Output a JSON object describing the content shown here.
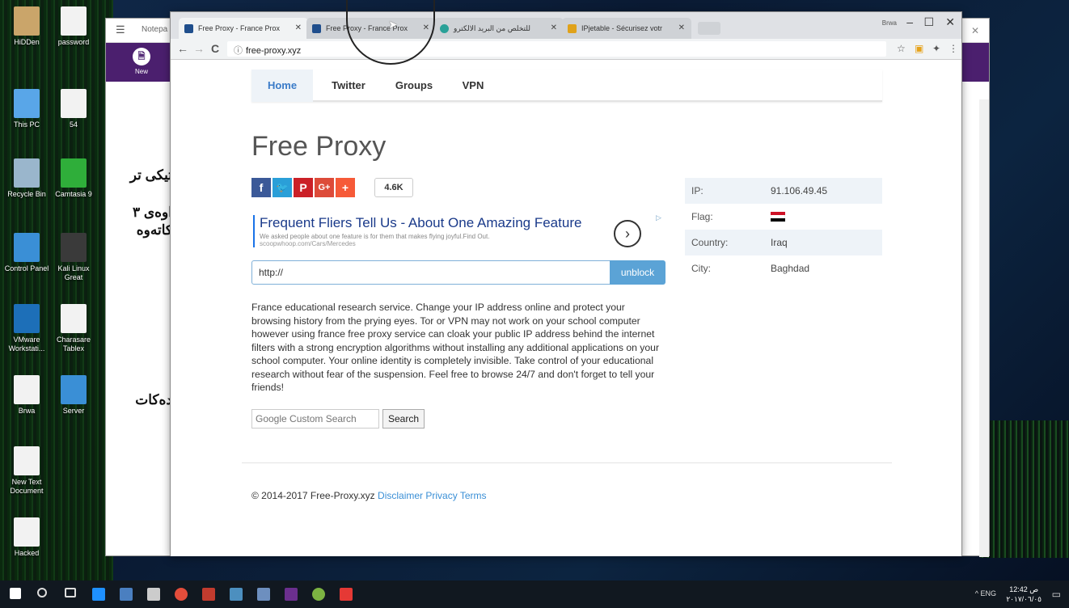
{
  "desktop": {
    "icons": [
      {
        "label": "HiDDen"
      },
      {
        "label": "password"
      },
      {
        "label": "This PC"
      },
      {
        "label": "54"
      },
      {
        "label": "Recycle Bin"
      },
      {
        "label": "Camtasia 9"
      },
      {
        "label": "Control Panel"
      },
      {
        "label": "Kali Linux Great"
      },
      {
        "label": "VMware Workstati..."
      },
      {
        "label": "Charasare Tablex"
      },
      {
        "label": "Brwa"
      },
      {
        "label": "Server"
      },
      {
        "label": "New Text Document"
      },
      {
        "label": "Hacked"
      }
    ]
  },
  "background_window": {
    "title": "Notepa",
    "new_label": "New",
    "texts": [
      "تیکی تر",
      "اوەی ٣",
      "کاتەوە",
      "دەکات"
    ]
  },
  "browser": {
    "tabs": [
      {
        "title": "Free Proxy - France Prox",
        "active": true,
        "favicon_color": "#1f4e8c"
      },
      {
        "title": "Free Proxy - France Prox",
        "active": false,
        "favicon_color": "#1f4e8c"
      },
      {
        "title": "للتخلص من البريد الالكترو",
        "active": false,
        "favicon_color": "#2aa198"
      },
      {
        "title": "IPjetable - Sécurisez votr",
        "active": false,
        "favicon_color": "#e0a21a"
      }
    ],
    "profile": "Brwa",
    "window_controls": {
      "minimize": "–",
      "maximize": "☐",
      "close": "✕"
    },
    "address": "free-proxy.xyz",
    "nav": {
      "back": "←",
      "forward": "→",
      "reload": "C"
    },
    "toolbar_icons": [
      "star-icon",
      "extension-icon",
      "pin-icon",
      "menu-icon"
    ]
  },
  "site": {
    "nav": [
      {
        "label": "Home",
        "active": true
      },
      {
        "label": "Twitter",
        "active": false
      },
      {
        "label": "Groups",
        "active": false
      },
      {
        "label": "VPN",
        "active": false
      }
    ],
    "title": "Free Proxy",
    "share": {
      "buttons": [
        {
          "glyph": "f",
          "color": "#3b5998",
          "name": "facebook-icon"
        },
        {
          "glyph": "🐦",
          "color": "#2a9fd8",
          "name": "twitter-icon"
        },
        {
          "glyph": "P",
          "color": "#cb2027",
          "name": "pinterest-icon"
        },
        {
          "glyph": "G+",
          "color": "#dd4b39",
          "name": "googleplus-icon"
        },
        {
          "glyph": "+",
          "color": "#f65a38",
          "name": "share-plus-icon"
        }
      ],
      "count": "4.6K"
    },
    "ad": {
      "headline": "Frequent Fliers Tell Us - About One Amazing Feature",
      "description": "We asked people about one feature is for them that makes flying joyful.Find Out.",
      "url": "scoopwhoop.com/Cars/Mercedes",
      "arrow": "›",
      "choice": "▷"
    },
    "url_form": {
      "value": "http://",
      "button": "unblock"
    },
    "description": "France educational research service. Change your IP address online and protect your browsing history from the prying eyes. Tor or VPN may not work on your school computer however using france free proxy service can cloak your public IP address behind the internet filters with a strong encryption algorithms without installing any additional applications on your school computer. Your online identity is completely invisible. Take control of your educational research without fear of the suspension. Feel free to browse 24/7 and don't forget to tell your friends!",
    "search": {
      "placeholder": "Google Custom Search",
      "button": "Search"
    },
    "info": [
      {
        "label": "IP:",
        "value": "91.106.49.45"
      },
      {
        "label": "Flag:",
        "value": ""
      },
      {
        "label": "Country:",
        "value": "Iraq"
      },
      {
        "label": "City:",
        "value": "Baghdad"
      }
    ],
    "flag_colors": [
      "#ce1126",
      "#ffffff",
      "#000000"
    ],
    "footer": {
      "copyright": "© 2014-2017 Free-Proxy.xyz",
      "links": [
        "Disclaimer",
        "Privacy",
        "Terms"
      ]
    }
  },
  "taskbar": {
    "tray_text": "^ ENG",
    "clock_time": "12:42 ص",
    "clock_date": "٢٠١٧/٠٦/٠٥"
  }
}
